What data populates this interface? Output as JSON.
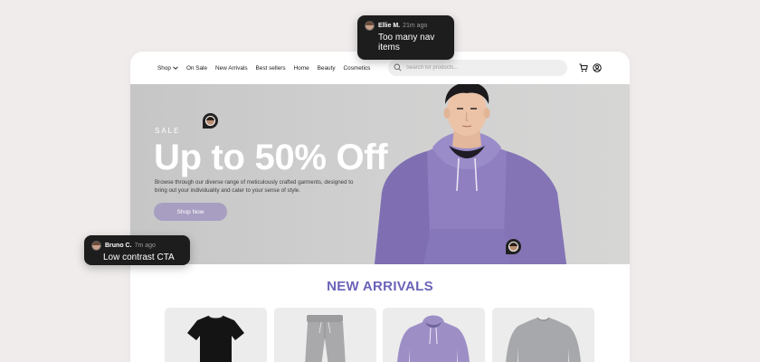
{
  "nav": {
    "links": [
      {
        "label": "Shop",
        "has_dropdown": true
      },
      {
        "label": "On Sale"
      },
      {
        "label": "New Arrivals"
      },
      {
        "label": "Best sellers"
      },
      {
        "label": "Home"
      },
      {
        "label": "Beauty"
      },
      {
        "label": "Cosmetics"
      }
    ],
    "search_placeholder": "Search for products...",
    "icons": [
      "search-icon",
      "cart-icon",
      "account-icon"
    ]
  },
  "hero": {
    "eyebrow": "SALE",
    "title": "Up to 50% Off",
    "description": "Browse through our diverse range of meticulously crafted garments, designed to bring out your individuality and cater to your sense of style.",
    "cta_label": "Shop Now",
    "cta_color": "#a79ec1"
  },
  "section": {
    "title": "NEW ARRIVALS",
    "title_color": "#6a63b8"
  },
  "products": [
    {
      "kind": "t-shirt",
      "color": "#141414"
    },
    {
      "kind": "sweatpants",
      "color": "#a9a9ab"
    },
    {
      "kind": "hoodie",
      "color": "#9d8fc6"
    },
    {
      "kind": "sweatshirt",
      "color": "#a7a8ab"
    }
  ],
  "comments": [
    {
      "author": "Ellie M.",
      "time": "21m ago",
      "text": "Too many nav items"
    },
    {
      "author": "Bruno C.",
      "time": "7m ago",
      "text": "Low contrast CTA"
    }
  ]
}
